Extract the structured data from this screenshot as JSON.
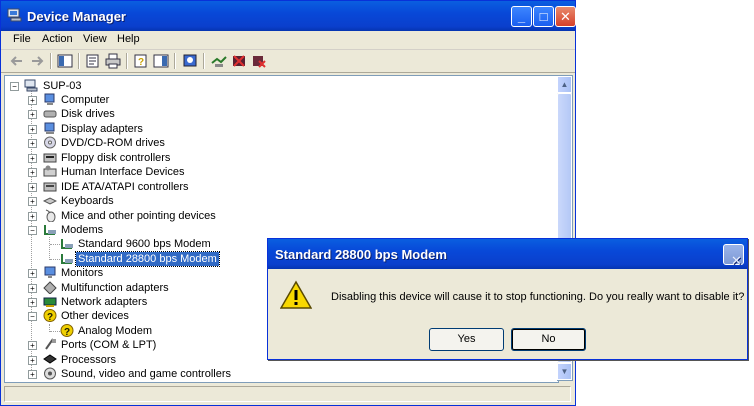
{
  "window": {
    "title": "Device Manager",
    "icon": "computer-icon"
  },
  "menu": [
    "File",
    "Action",
    "View",
    "Help"
  ],
  "tree": {
    "root": "SUP-03",
    "items": [
      {
        "label": "Computer",
        "icon": "computer-icon"
      },
      {
        "label": "Disk drives",
        "icon": "disk-drive-icon"
      },
      {
        "label": "Display adapters",
        "icon": "display-adapter-icon"
      },
      {
        "label": "DVD/CD-ROM drives",
        "icon": "cdrom-icon"
      },
      {
        "label": "Floppy disk controllers",
        "icon": "floppy-controller-icon"
      },
      {
        "label": "Human Interface Devices",
        "icon": "hid-icon"
      },
      {
        "label": "IDE ATA/ATAPI controllers",
        "icon": "ide-controller-icon"
      },
      {
        "label": "Keyboards",
        "icon": "keyboard-icon"
      },
      {
        "label": "Mice and other pointing devices",
        "icon": "mouse-icon"
      },
      {
        "label": "Modems",
        "icon": "modem-icon",
        "children": [
          {
            "label": "Standard  9600 bps Modem",
            "icon": "modem-icon"
          },
          {
            "label": "Standard 28800 bps Modem",
            "icon": "modem-icon",
            "selected": true
          }
        ]
      },
      {
        "label": "Monitors",
        "icon": "monitor-icon"
      },
      {
        "label": "Multifunction adapters",
        "icon": "multifunction-icon"
      },
      {
        "label": "Network adapters",
        "icon": "network-adapter-icon"
      },
      {
        "label": "Other devices",
        "icon": "unknown-device-icon",
        "children": [
          {
            "label": "Analog Modem",
            "icon": "unknown-device-icon"
          }
        ]
      },
      {
        "label": "Ports (COM & LPT)",
        "icon": "port-icon"
      },
      {
        "label": "Processors",
        "icon": "processor-icon"
      },
      {
        "label": "Sound, video and game controllers",
        "icon": "sound-icon"
      }
    ]
  },
  "dialog": {
    "title": "Standard 28800 bps Modem",
    "message": "Disabling this device will cause it to stop functioning. Do you really want to disable it?",
    "yes": "Yes",
    "no": "No",
    "icon": "warning-icon"
  }
}
